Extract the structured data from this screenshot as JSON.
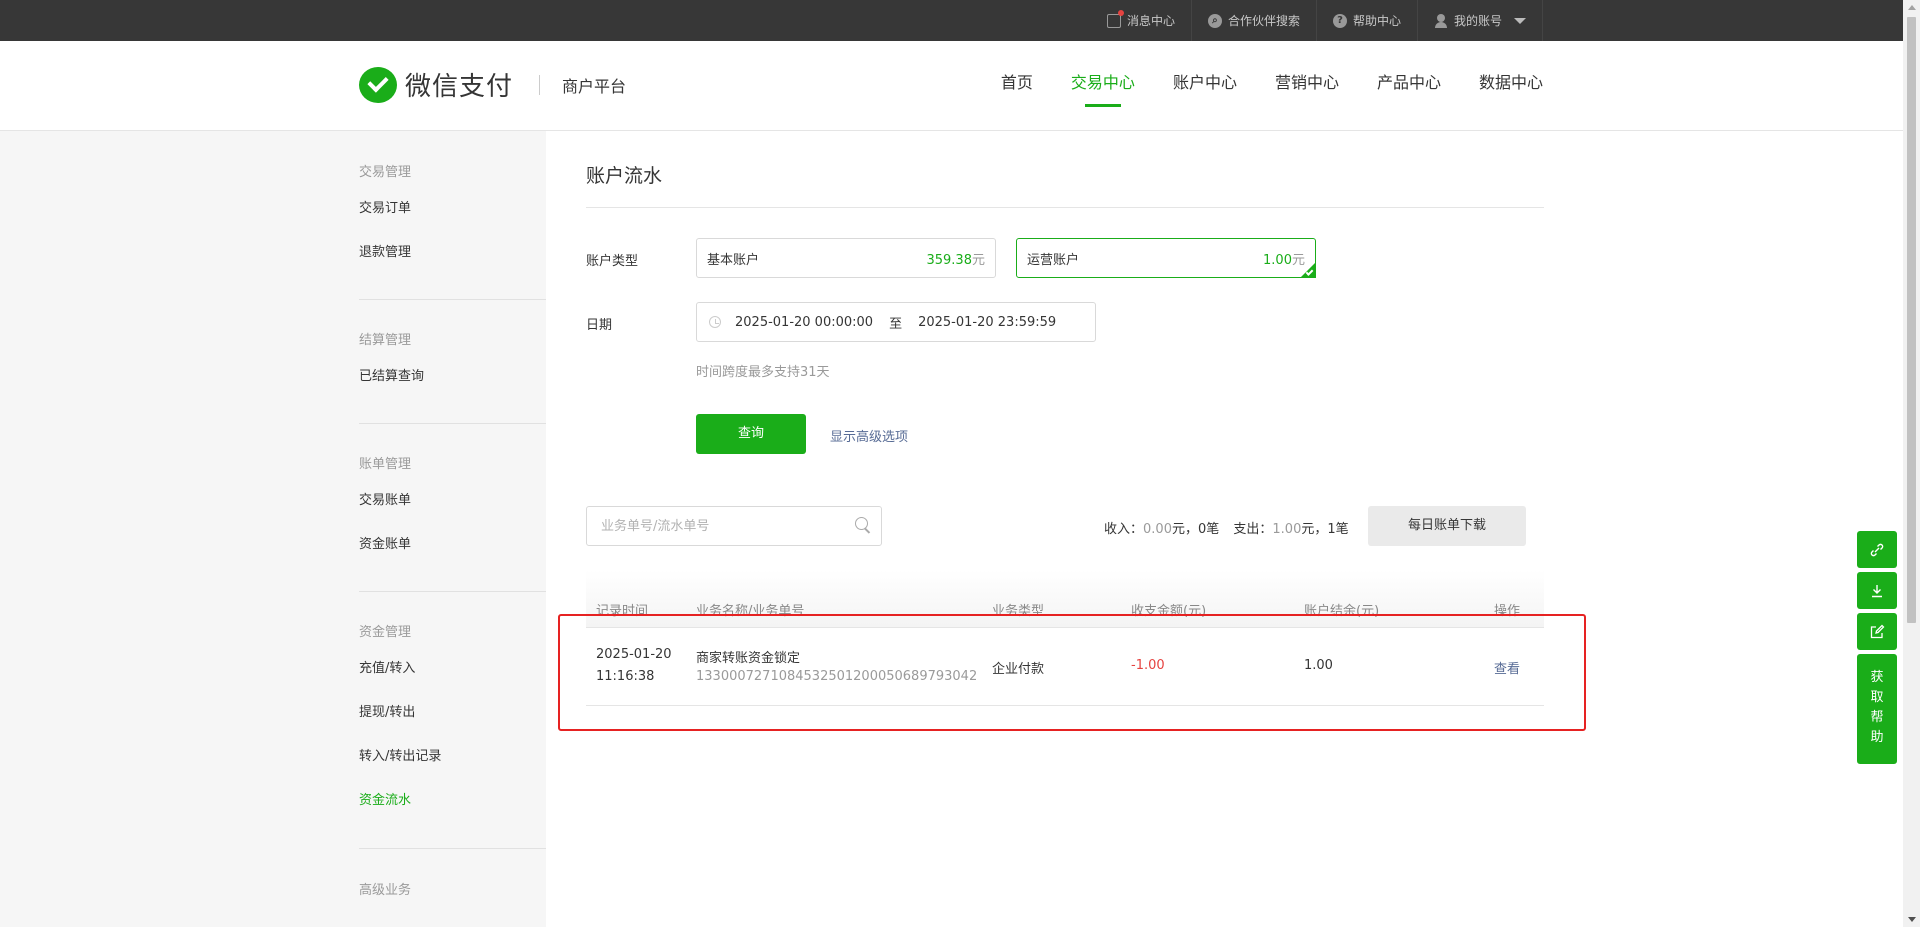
{
  "topbar": {
    "links": [
      {
        "label": "消息中心",
        "icon": "message-icon"
      },
      {
        "label": "合作伙伴搜索",
        "icon": "search-circle-icon"
      },
      {
        "label": "帮助中心",
        "icon": "help-icon"
      },
      {
        "label": "我的账号",
        "icon": "user-icon"
      }
    ]
  },
  "header": {
    "logo_text": "微信支付",
    "platform": "商户平台",
    "nav": [
      "首页",
      "交易中心",
      "账户中心",
      "营销中心",
      "产品中心",
      "数据中心"
    ],
    "active_nav": "交易中心"
  },
  "sidebar": {
    "groups": [
      {
        "title": "交易管理",
        "items": [
          "交易订单",
          "退款管理"
        ]
      },
      {
        "title": "结算管理",
        "items": [
          "已结算查询"
        ]
      },
      {
        "title": "账单管理",
        "items": [
          "交易账单",
          "资金账单"
        ]
      },
      {
        "title": "资金管理",
        "items": [
          "充值/转入",
          "提现/转出",
          "转入/转出记录",
          "资金流水"
        ]
      },
      {
        "title": "高级业务",
        "items": []
      }
    ],
    "active_item": "资金流水"
  },
  "main": {
    "title": "账户流水",
    "account_type_label": "账户类型",
    "accounts": [
      {
        "name": "基本账户",
        "amount": "359.38",
        "unit": "元",
        "selected": false
      },
      {
        "name": "运营账户",
        "amount": "1.00",
        "unit": "元",
        "selected": true
      }
    ],
    "date_label": "日期",
    "date_start": "2025-01-20 00:00:00",
    "date_sep": "至",
    "date_end": "2025-01-20 23:59:59",
    "date_hint": "时间跨度最多支持31天",
    "query_button": "查询",
    "advanced_link": "显示高级选项",
    "search_placeholder": "业务单号/流水单号",
    "summary": {
      "income_label": "收入：",
      "income_amount": "0.00",
      "income_suffix": "元，0笔",
      "expense_label": "支出：",
      "expense_amount": "1.00",
      "expense_suffix": "元，1笔"
    },
    "download_button": "每日账单下载",
    "table": {
      "headers": [
        "记录时间",
        "业务名称/业务单号",
        "业务类型",
        "收支金额(元)",
        "账户结余(元)",
        "操作"
      ],
      "rows": [
        {
          "date": "2025-01-20",
          "time": "11:16:38",
          "name": "商家转账资金锁定",
          "number": "1330007271084532501200050689793042",
          "type": "企业付款",
          "amount": "-1.00",
          "balance": "1.00",
          "action": "查看"
        }
      ]
    }
  },
  "float_toolbar": {
    "icons": [
      "link-icon",
      "download-icon",
      "edit-icon"
    ],
    "help_label": [
      "获",
      "取",
      "帮",
      "助"
    ]
  },
  "colors": {
    "brand_green": "#1aad19",
    "link_blue": "#576b95",
    "negative_red": "#e64340",
    "highlight_red": "#e62222",
    "topbar_bg": "#373737"
  }
}
